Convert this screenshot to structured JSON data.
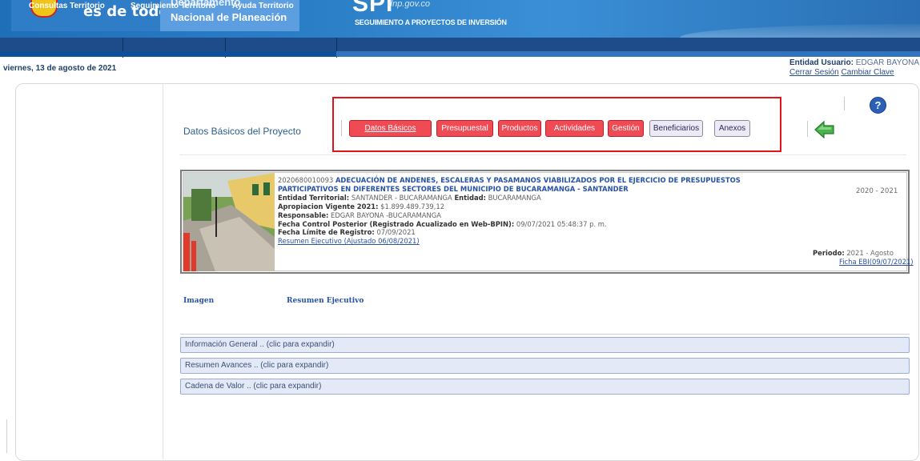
{
  "header": {
    "logo_text": "es de todos",
    "dnp_line1": "Departamento",
    "dnp_line2": "Nacional de Planeación",
    "spi_logo": "SPI",
    "spi_url": "dnp.gov.co",
    "spi_subtitle": "SEGUIMIENTO A PROYECTOS DE INVERSIÓN"
  },
  "nav": {
    "items": [
      "Consultas Territorio",
      "Seguimiento Territorio",
      "Ayuda Territorio"
    ]
  },
  "status": {
    "date": "viernes, 13 de agosto de 2021",
    "user_label": "Entidad Usuario:",
    "user_name": "EDGAR BAYONA",
    "logout": "Cerrar Sesión",
    "change_password": "Cambiar Clave"
  },
  "section": {
    "title": "Datos Básicos del Proyecto",
    "tabs": [
      "Datos Básicos",
      "Presupuestal",
      "Productos",
      "Actividades",
      "Gestión",
      "Beneficiarios",
      "Anexos"
    ],
    "help": "?"
  },
  "project": {
    "code": "2020680010093",
    "title": "ADECUACIÓN DE ANDENES, ESCALERAS Y PASAMANOS VIABILIZADOS POR EL EJERCICIO DE PRESUPUESTOS PARTICIPATIVOS EN DIFERENTES SECTORES DEL MUNICIPIO DE BUCARAMANGA - SANTANDER",
    "entidad_territorial_label": "Entidad Territorial:",
    "entidad_territorial": "SANTANDER - BUCARAMANGA",
    "entidad_label": "Entidad:",
    "entidad": "BUCARAMANGA",
    "apropiacion_label": "Apropiacion Vigente 2021:",
    "apropiacion": "$1.899.489.739,12",
    "responsable_label": "Responsable:",
    "responsable": "EDGAR BAYONA -BUCARAMANGA",
    "fecha_control_label": "Fecha Control Posterior (Registrado Acualizado en Web-BPIN):",
    "fecha_control": "09/07/2021 05:48:37 p. m.",
    "fecha_limite_label": "Fecha Límite de Registro:",
    "fecha_limite": "07/09/2021",
    "resumen_link": "Resumen Ejecutivo (Ajustado 06/08/2021)",
    "years": "2020 - 2021",
    "periodo_label": "Periodo:",
    "periodo": "2021 - Agosto",
    "ficha_link": "Ficha EBI(09/07/2021)"
  },
  "labels": {
    "imagen": "Imagen",
    "resumen": "Resumen Ejecutivo"
  },
  "accordions": [
    "Información General .. (clic para expandir)",
    "Resumen Avances .. (clic para expandir)",
    "Cadena de Valor .. (clic para expandir)"
  ],
  "colors": {
    "header_blue": "#2b7fc7",
    "nav_blue": "#1e4c8a",
    "tab_red": "#f04b55",
    "highlight_red": "#e3121b",
    "accordion_bg": "#e3e9f7"
  }
}
